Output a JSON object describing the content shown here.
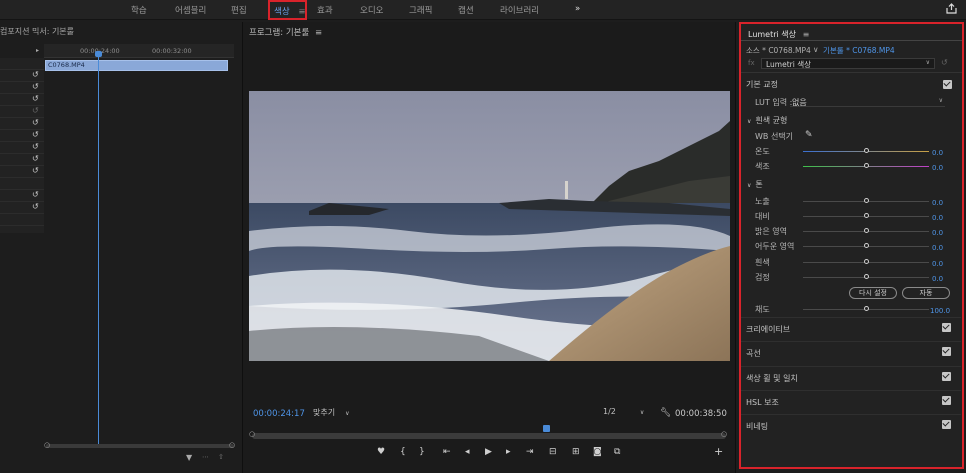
{
  "workspaces": {
    "learn": "학습",
    "assembly": "어셈블리",
    "editing": "편집",
    "color": "색상",
    "effects": "효과",
    "audio": "오디오",
    "graphics": "그래픽",
    "captions": "캡션",
    "libraries": "라이브러리",
    "more": "»",
    "active_menu": "≡"
  },
  "timeline": {
    "title": "컴포지션 믹서: 기본룰",
    "ticks": [
      "00:00:24:00",
      "00:00:32:00"
    ],
    "clip_name": "C0768.MP4"
  },
  "program": {
    "title": "프로그램: 기본룰",
    "timecode": "00:00:24:17",
    "fit": "맞추기",
    "resolution": "1/2",
    "duration": "00:00:38:50",
    "playhead_fraction": 0.62
  },
  "lumetri": {
    "title": "Lumetri 색상",
    "source": "소스 * C0768.MP4",
    "target": "기본룰 * C0768.MP4",
    "fx_name": "Lumetri 색상",
    "sections": {
      "basic": "기본 교정",
      "lut_label": "LUT 입력",
      "lut_value": "없음",
      "wb": "흰색 균형",
      "wb_picker": "WB 선택기",
      "tone": "톤",
      "creative": "크리에이티브",
      "curves": "곡선",
      "wheels": "색상 휠 및 일치",
      "hsl": "HSL 보조",
      "vignette": "비네팅"
    },
    "sliders": [
      {
        "label": "온도",
        "value": "0.0"
      },
      {
        "label": "색조",
        "value": "0.0"
      },
      {
        "label": "노출",
        "value": "0.0"
      },
      {
        "label": "대비",
        "value": "0.0"
      },
      {
        "label": "밝은 영역",
        "value": "0.0"
      },
      {
        "label": "어두운 영역",
        "value": "0.0"
      },
      {
        "label": "흰색",
        "value": "0.0"
      },
      {
        "label": "검정",
        "value": "0.0"
      },
      {
        "label": "채도",
        "value": "100.0"
      }
    ],
    "reset_label": "다시 설정",
    "auto_label": "자동"
  },
  "colors": {
    "accent": "#4f95e8",
    "highlight": "#d9232b"
  }
}
